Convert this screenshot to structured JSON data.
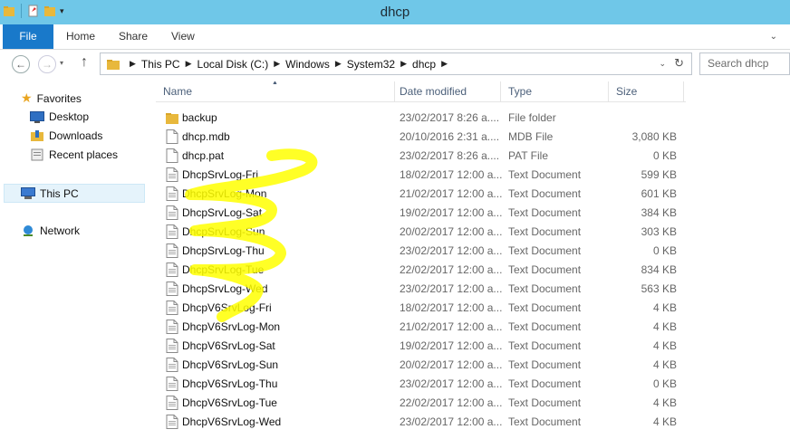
{
  "window": {
    "title": "dhcp"
  },
  "ribbon": {
    "tabs": [
      "File",
      "Home",
      "Share",
      "View"
    ]
  },
  "address": {
    "crumbs": [
      "This PC",
      "Local Disk (C:)",
      "Windows",
      "System32",
      "dhcp"
    ],
    "search_placeholder": "Search dhcp"
  },
  "nav": {
    "favorites": "Favorites",
    "desktop": "Desktop",
    "downloads": "Downloads",
    "recent": "Recent places",
    "thispc": "This PC",
    "network": "Network"
  },
  "columns": {
    "name": "Name",
    "date": "Date modified",
    "type": "Type",
    "size": "Size"
  },
  "files": [
    {
      "name": "backup",
      "date": "23/02/2017 8:26 a....",
      "type": "File folder",
      "size": "",
      "icon": "folder-icon"
    },
    {
      "name": "dhcp.mdb",
      "date": "20/10/2016 2:31 a....",
      "type": "MDB File",
      "size": "3,080 KB",
      "icon": "file-icon"
    },
    {
      "name": "dhcp.pat",
      "date": "23/02/2017 8:26 a....",
      "type": "PAT File",
      "size": "0 KB",
      "icon": "file-icon"
    },
    {
      "name": "DhcpSrvLog-Fri",
      "date": "18/02/2017 12:00 a...",
      "type": "Text Document",
      "size": "599 KB",
      "icon": "text-document-icon"
    },
    {
      "name": "DhcpSrvLog-Mon",
      "date": "21/02/2017 12:00 a...",
      "type": "Text Document",
      "size": "601 KB",
      "icon": "text-document-icon"
    },
    {
      "name": "DhcpSrvLog-Sat",
      "date": "19/02/2017 12:00 a...",
      "type": "Text Document",
      "size": "384 KB",
      "icon": "text-document-icon"
    },
    {
      "name": "DhcpSrvLog-Sun",
      "date": "20/02/2017 12:00 a...",
      "type": "Text Document",
      "size": "303 KB",
      "icon": "text-document-icon"
    },
    {
      "name": "DhcpSrvLog-Thu",
      "date": "23/02/2017 12:00 a...",
      "type": "Text Document",
      "size": "0 KB",
      "icon": "text-document-icon"
    },
    {
      "name": "DhcpSrvLog-Tue",
      "date": "22/02/2017 12:00 a...",
      "type": "Text Document",
      "size": "834 KB",
      "icon": "text-document-icon"
    },
    {
      "name": "DhcpSrvLog-Wed",
      "date": "23/02/2017 12:00 a...",
      "type": "Text Document",
      "size": "563 KB",
      "icon": "text-document-icon"
    },
    {
      "name": "DhcpV6SrvLog-Fri",
      "date": "18/02/2017 12:00 a...",
      "type": "Text Document",
      "size": "4 KB",
      "icon": "text-document-icon"
    },
    {
      "name": "DhcpV6SrvLog-Mon",
      "date": "21/02/2017 12:00 a...",
      "type": "Text Document",
      "size": "4 KB",
      "icon": "text-document-icon"
    },
    {
      "name": "DhcpV6SrvLog-Sat",
      "date": "19/02/2017 12:00 a...",
      "type": "Text Document",
      "size": "4 KB",
      "icon": "text-document-icon"
    },
    {
      "name": "DhcpV6SrvLog-Sun",
      "date": "20/02/2017 12:00 a...",
      "type": "Text Document",
      "size": "4 KB",
      "icon": "text-document-icon"
    },
    {
      "name": "DhcpV6SrvLog-Thu",
      "date": "23/02/2017 12:00 a...",
      "type": "Text Document",
      "size": "0 KB",
      "icon": "text-document-icon"
    },
    {
      "name": "DhcpV6SrvLog-Tue",
      "date": "22/02/2017 12:00 a...",
      "type": "Text Document",
      "size": "4 KB",
      "icon": "text-document-icon"
    },
    {
      "name": "DhcpV6SrvLog-Wed",
      "date": "23/02/2017 12:00 a...",
      "type": "Text Document",
      "size": "4 KB",
      "icon": "text-document-icon"
    }
  ],
  "colors": {
    "titlebar": "#6fc7e8",
    "file_tab": "#1979ca",
    "header_text": "#4c607a",
    "scribble": "#ffff00"
  }
}
